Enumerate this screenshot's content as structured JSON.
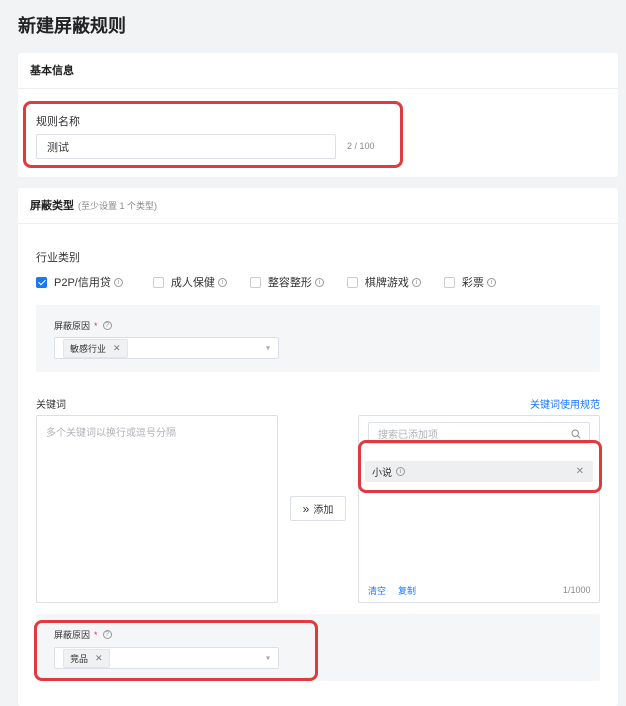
{
  "page_title": "新建屏蔽规则",
  "basic_info": {
    "header": "基本信息",
    "rule_name_label": "规则名称",
    "rule_name_value": "测试",
    "rule_name_counter": "2 / 100"
  },
  "block_type": {
    "header": "屏蔽类型",
    "header_hint": "(至少设置 1 个类型)",
    "industry": {
      "label": "行业类别",
      "categories": [
        {
          "label": "P2P/信用贷",
          "checked": true
        },
        {
          "label": "成人保健",
          "checked": false
        },
        {
          "label": "整容整形",
          "checked": false
        },
        {
          "label": "棋牌游戏",
          "checked": false
        },
        {
          "label": "彩票",
          "checked": false
        }
      ],
      "reason_label": "屏蔽原因",
      "reason_required_mark": "*",
      "reason_tag": "敏感行业"
    },
    "keywords": {
      "label": "关键词",
      "guide_link": "关键词使用规范",
      "textarea_placeholder": "多个关键词以换行或逗号分隔",
      "add_button": "添加",
      "add_icon": "»",
      "search_placeholder": "搜索已添加项",
      "items": [
        {
          "label": "小说"
        }
      ],
      "clear_link": "清空",
      "copy_link": "复制",
      "counter": "1/1000",
      "reason_label": "屏蔽原因",
      "reason_required_mark": "*",
      "reason_tag": "竞品"
    }
  },
  "colors": {
    "accent": "#1677ff",
    "highlight_box": "#e0393e",
    "required": "#e0393e"
  }
}
